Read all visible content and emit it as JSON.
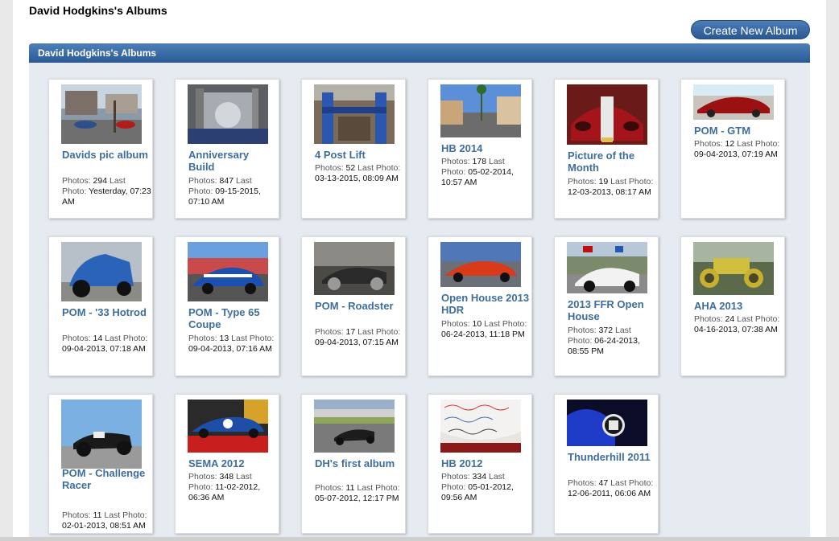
{
  "page_title": "David Hodgkins's Albums",
  "create_button": "Create New Album",
  "panel_title": "David Hodgkins's Albums",
  "labels": {
    "photos": "Photos:",
    "last": "Last",
    "photo": "Photo:"
  },
  "albums": [
    {
      "title": "Davids pic album",
      "photos": "294",
      "last": "Yesterday, 07:23 AM"
    },
    {
      "title": "Anniversary Build",
      "photos": "847",
      "last": "09-15-2015, 07:10 AM"
    },
    {
      "title": "4 Post Lift",
      "photos": "52",
      "last": "03-13-2015, 08:09 AM"
    },
    {
      "title": "HB 2014",
      "photos": "178",
      "last": "05-02-2014, 10:57 AM"
    },
    {
      "title": "Picture of the Month",
      "photos": "19",
      "last": "12-03-2013, 08:17 AM"
    },
    {
      "title": "POM - GTM",
      "photos": "12",
      "last": "09-04-2013, 07:19 AM"
    },
    {
      "title": "POM - '33 Hotrod",
      "photos": "14",
      "last": "09-04-2013, 07:18 AM"
    },
    {
      "title": "POM - Type 65 Coupe",
      "photos": "13",
      "last": "09-04-2013, 07:16 AM"
    },
    {
      "title": "POM - Roadster",
      "photos": "17",
      "last": "09-04-2013, 07:15 AM"
    },
    {
      "title": "Open House 2013 HDR",
      "photos": "10",
      "last": "06-24-2013, 11:18 PM"
    },
    {
      "title": "2013 FFR Open House",
      "photos": "372",
      "last": "06-24-2013, 08:55 PM"
    },
    {
      "title": "AHA 2013",
      "photos": "24",
      "last": "04-16-2013, 07:38 AM"
    },
    {
      "title": "POM - Challenge Racer",
      "photos": "11",
      "last": "02-01-2013, 08:51 AM"
    },
    {
      "title": "SEMA 2012",
      "photos": "348",
      "last": "11-02-2012, 06:36 AM"
    },
    {
      "title": "DH's first album",
      "photos": "11",
      "last": "05-07-2012, 12:17 PM"
    },
    {
      "title": "HB 2012",
      "photos": "334",
      "last": "05-01-2012, 09:56 AM"
    },
    {
      "title": "Thunderhill 2011",
      "photos": "47",
      "last": "12-06-2011, 06:06 AM"
    }
  ]
}
